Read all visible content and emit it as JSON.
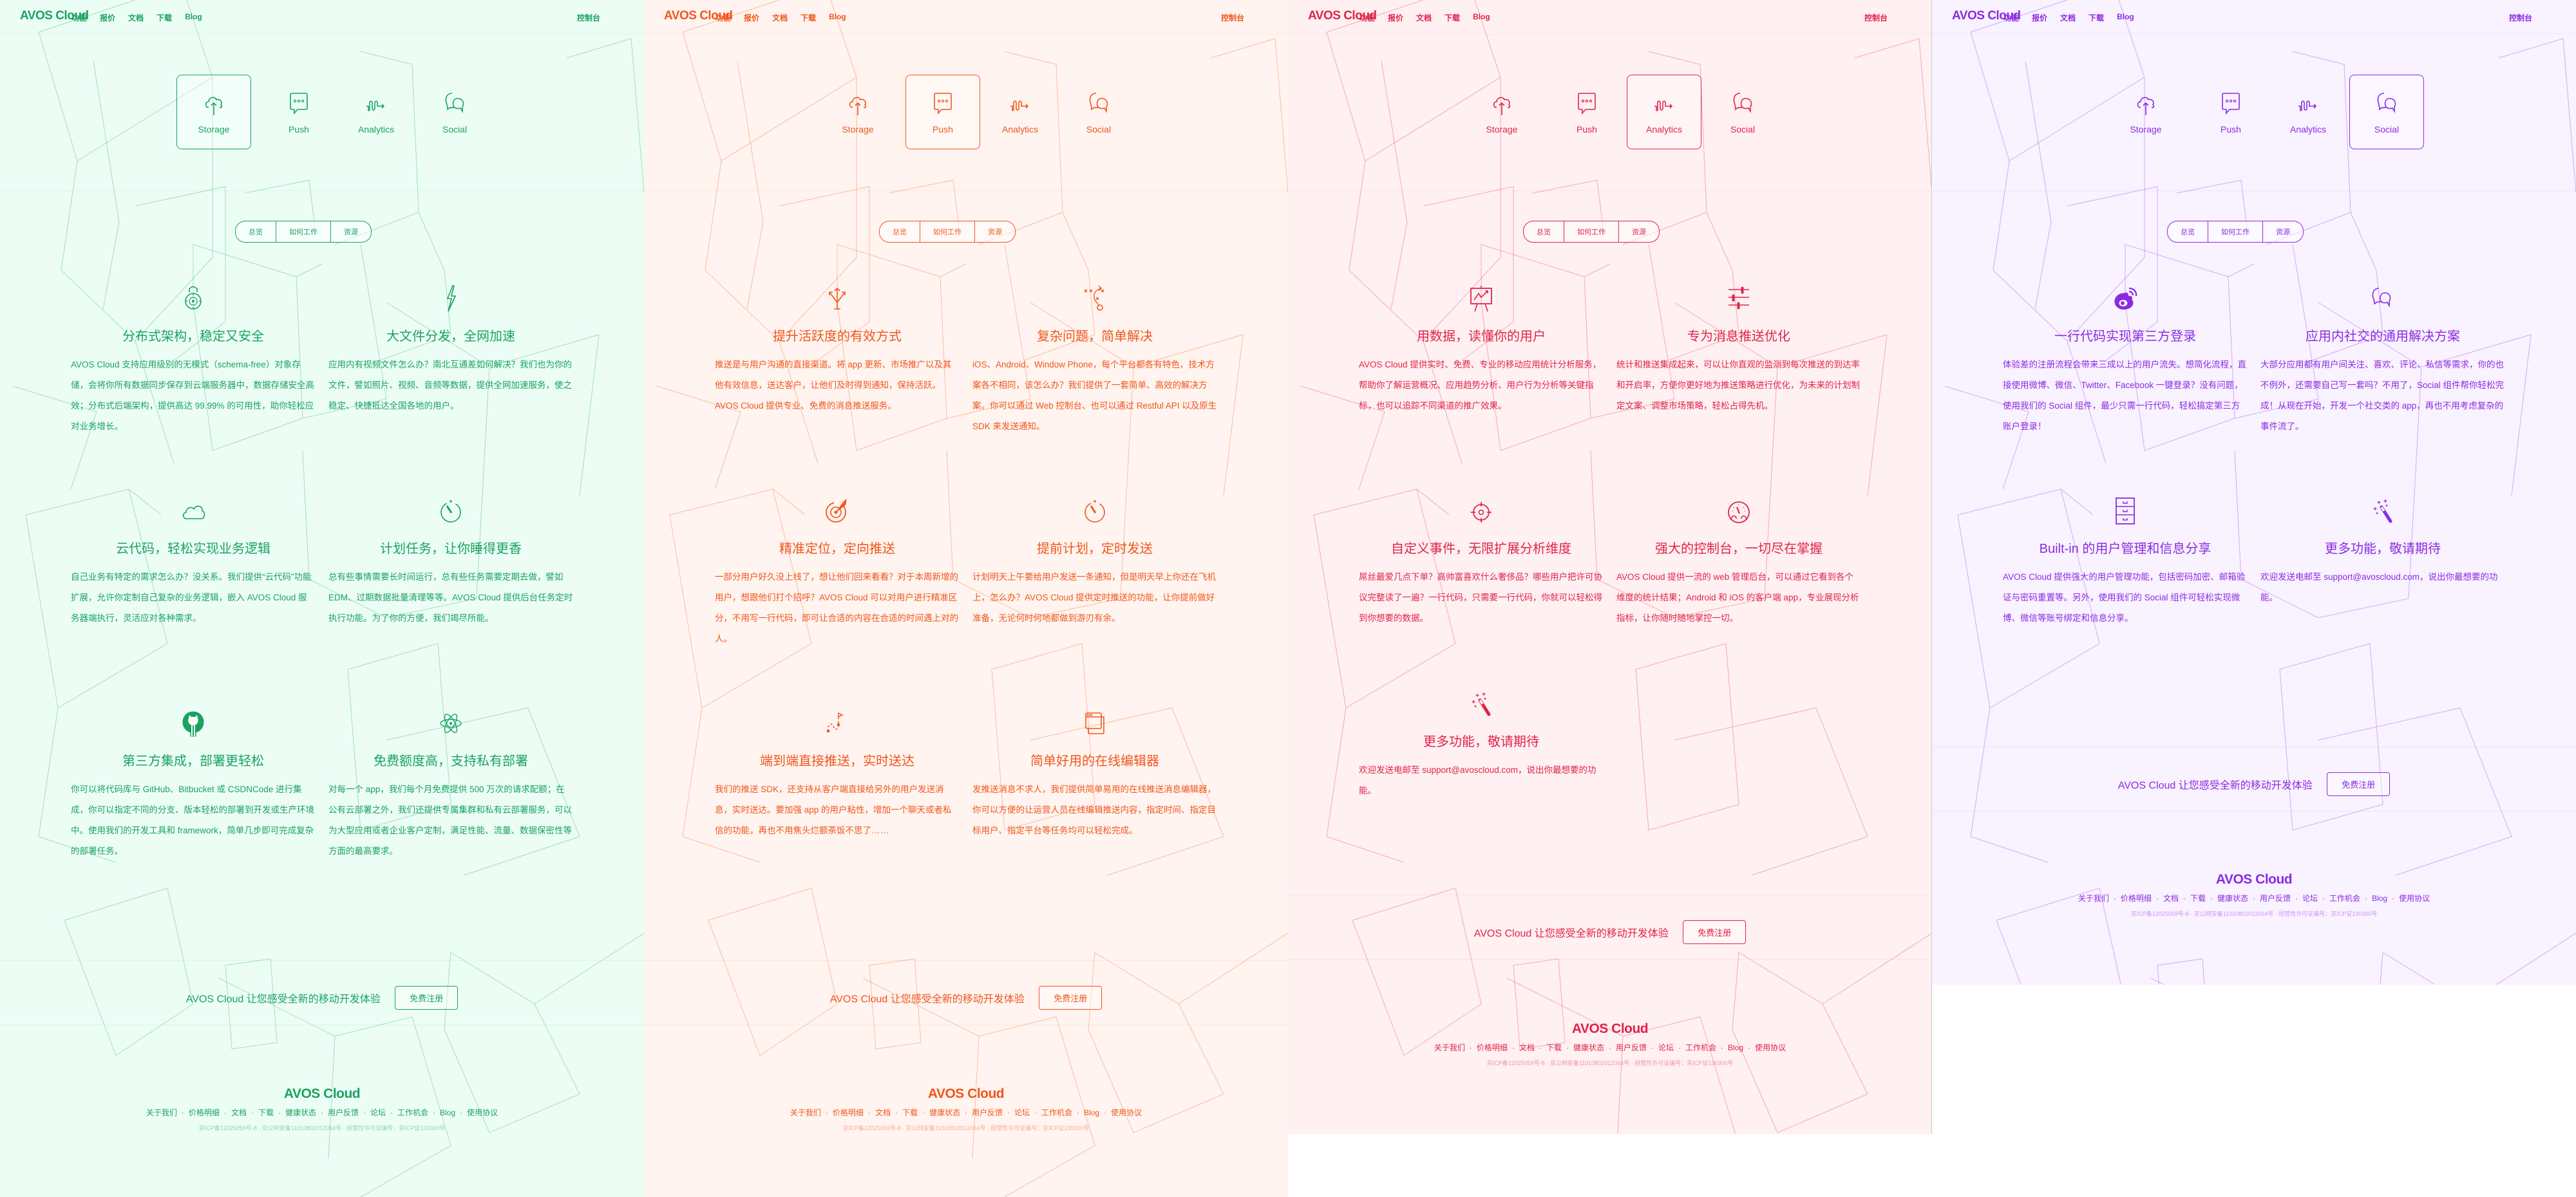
{
  "common": {
    "logo": "AVOS Cloud",
    "nav": [
      "功能",
      "报价",
      "文档",
      "下载",
      "Blog"
    ],
    "console": "控制台",
    "products": [
      "Storage",
      "Push",
      "Analytics",
      "Social"
    ],
    "subnav": [
      "总览",
      "如何工作",
      "资源"
    ],
    "cta_text": "AVOS Cloud 让您感受全新的移动开发体验",
    "cta_button": "免费注册",
    "footer_logo": "AVOS Cloud",
    "footer_links": [
      "关于我们",
      "价格明细",
      "文档",
      "下载",
      "健康状态",
      "用户反馈",
      "论坛",
      "工作机会",
      "Blog",
      "使用协议"
    ],
    "icp": "京ICP备12025059号-8 · 京公网安备11010802012064号 · 经营性许可证编号：京ICP证130300号"
  },
  "panels": [
    {
      "product": "Storage",
      "active_tab": 0,
      "accent": "#1aa260",
      "bg": "#ecfdf6",
      "features": [
        {
          "icon": "lock-icon",
          "title": "分布式架构，稳定又安全",
          "body": "AVOS Cloud 支持应用级别的无模式（schema-free）对象存储，会将你所有数据同步保存到云端服务器中，数据存储安全高效；分布式后端架构，提供高达 99.99% 的可用性，助你轻松应对业务增长。"
        },
        {
          "icon": "lightning-icon",
          "title": "大文件分发，全网加速",
          "body": "应用内有视频文件怎么办？南北互通差如何解决？我们也为你的文件，譬如照片、视频、音频等数据，提供全网加速服务，使之稳定、快捷抵达全国各地的用户。"
        },
        {
          "icon": "cloud-icon",
          "title": "云代码，轻松实现业务逻辑",
          "body": "自己业务有特定的需求怎么办？没关系。我们提供“云代码”功能扩展，允许你定制自己复杂的业务逻辑，嵌入 AVOS Cloud 服务器端执行，灵活应对各种需求。"
        },
        {
          "icon": "stopwatch-icon",
          "title": "计划任务，让你睡得更香",
          "body": "总有些事情需要长时间运行，总有些任务需要定期去做，譬如 EDM、过期数据批量清理等等。AVOS Cloud 提供后台任务定时执行功能。为了你的方便，我们竭尽所能。"
        },
        {
          "icon": "github-icon",
          "title": "第三方集成，部署更轻松",
          "body": "你可以将代码库与 GitHub、Bitbucket 或 CSDNCode 进行集成，你可以指定不同的分支、版本轻松的部署到开发或生产环境中。使用我们的开发工具和 framework，简单几步即可完成复杂的部署任务。"
        },
        {
          "icon": "atom-icon",
          "title": "免费额度高，支持私有部署",
          "body": "对每一个 app，我们每个月免费提供 500 万次的请求配额；在公有云部署之外，我们还提供专属集群和私有云部署服务，可以为大型应用或者企业客户定制，满足性能、流量、数据保密性等方面的最高要求。"
        }
      ]
    },
    {
      "product": "Push",
      "active_tab": 1,
      "accent": "#f0561d",
      "bg": "#fff4ef",
      "features": [
        {
          "icon": "arrows-up-icon",
          "title": "提升活跃度的有效方式",
          "body": "推送是与用户沟通的直接渠道。将 app 更新、市场推广以及其他有效信息，送达客户，让他们及时得到通知，保持活跃。AVOS Cloud 提供专业、免费的消息推送服务。"
        },
        {
          "icon": "tactics-icon",
          "title": "复杂问题，简单解决",
          "body": "iOS、Android、Window Phone，每个平台都各有特色，技术方案各不相同，该怎么办？我们提供了一套简单、高效的解决方案。你可以通过 Web 控制台、也可以通过 Restful API 以及原生 SDK 来发送通知。"
        },
        {
          "icon": "target-dart-icon",
          "title": "精准定位，定向推送",
          "body": "一部分用户好久没上线了，想让他们回来看看？对于本周新增的用户，想跟他们打个招呼？AVOS Cloud 可以对用户进行精准区分，不用写一行代码，即可让合适的内容在合适的时间遇上对的人。"
        },
        {
          "icon": "stopwatch-icon",
          "title": "提前计划，定时发送",
          "body": "计划明天上午要给用户发送一条通知，但是明天早上你还在飞机上，怎么办？AVOS Cloud 提供定时推送的功能，让你提前做好准备，无论何时何地都做到游刃有余。"
        },
        {
          "icon": "route-flag-icon",
          "title": "端到端直接推送，实时送达",
          "body": "我们的推送 SDK，还支持从客户端直接给另外的用户发送消息，实时送达。要加强 app 的用户粘性，增加一个聊天或者私信的功能，再也不用焦头烂额茶饭不思了……"
        },
        {
          "icon": "browser-windows-icon",
          "title": "简单好用的在线编辑器",
          "body": "发推送消息不求人，我们提供简单易用的在线推送消息编辑器，你可以方便的让运营人员在线编辑推送内容，指定时间、指定目标用户、指定平台等任务均可以轻松完成。"
        }
      ]
    },
    {
      "product": "Analytics",
      "active_tab": 2,
      "accent": "#e0244a",
      "bg": "#fff0f2",
      "features": [
        {
          "icon": "chart-board-icon",
          "title": "用数据，读懂你的用户",
          "body": "AVOS Cloud 提供实时、免费、专业的移动应用统计分析服务，帮助你了解运营概况、应用趋势分析、用户行为分析等关键指标，也可以追踪不同渠道的推广效果。"
        },
        {
          "icon": "sliders-icon",
          "title": "专为消息推送优化",
          "body": "统计和推送集成起来，可以让你直观的监测到每次推送的到达率和开启率，方便你更好地为推送策略进行优化，为未来的计划制定文案、调整市场策略，轻松占得先机。"
        },
        {
          "icon": "crosshair-icon",
          "title": "自定义事件，无限扩展分析维度",
          "body": "屌丝最爱几点下单？高帅富喜欢什么奢侈品？哪些用户把许可协议完整读了一遍？一行代码，只需要一行代码，你就可以轻松得到你想要的数据。"
        },
        {
          "icon": "dashboard-gauge-icon",
          "title": "强大的控制台，一切尽在掌握",
          "body": "AVOS Cloud 提供一流的 web 管理后台，可以通过它看到各个维度的统计结果；Android 和 iOS 的客户端 app，专业展现分析指标，让你随时随地掌控一切。"
        },
        {
          "icon": "magic-wand-icon",
          "title": "更多功能，敬请期待",
          "body": "欢迎发送电邮至 support@avoscloud.com，说出你最想要的功能。"
        }
      ]
    },
    {
      "product": "Social",
      "active_tab": 3,
      "accent": "#8a2be2",
      "bg": "#f9f2ff",
      "features": [
        {
          "icon": "weibo-icon",
          "title": "一行代码实现第三方登录",
          "body": "体验差的注册流程会带来三成以上的用户流失。想简化流程，直接使用微博、微信、Twitter、Facebook 一键登录？没有问题，使用我们的 Social 组件，最少只需一行代码，轻松搞定第三方账户登录！"
        },
        {
          "icon": "chat-bubbles-icon",
          "title": "应用内社交的通用解决方案",
          "body": "大部分应用都有用户间关注、喜欢、评论、私信等需求，你的也不例外，还需要自己写一套吗？不用了，Social 组件帮你轻松完成！从现在开始，开发一个社交类的 app，再也不用考虑复杂的事件流了。"
        },
        {
          "icon": "file-cabinet-icon",
          "title": "Built-in 的用户管理和信息分享",
          "body": "AVOS Cloud 提供强大的用户管理功能，包括密码加密、邮箱验证与密码重置等。另外，使用我们的 Social 组件可轻松实现微博、微信等账号绑定和信息分享。"
        },
        {
          "icon": "magic-wand-icon",
          "title": "更多功能，敬请期待",
          "body": "欢迎发送电邮至 support@avoscloud.com，说出你最想要的功能。"
        }
      ]
    }
  ]
}
